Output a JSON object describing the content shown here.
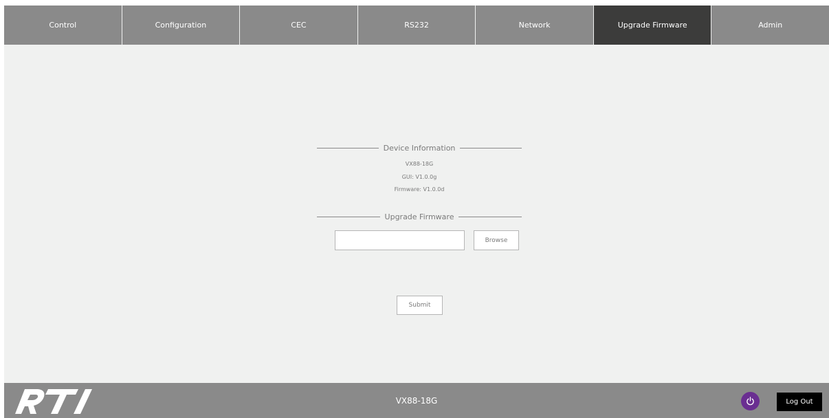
{
  "nav": {
    "tabs": [
      {
        "label": "Control",
        "active": false
      },
      {
        "label": "Configuration",
        "active": false
      },
      {
        "label": "CEC",
        "active": false
      },
      {
        "label": "RS232",
        "active": false
      },
      {
        "label": "Network",
        "active": false
      },
      {
        "label": "Upgrade Firmware",
        "active": true
      },
      {
        "label": "Admin",
        "active": false
      }
    ]
  },
  "device_info": {
    "heading": "Device Information",
    "model": "VX88-18G",
    "gui_version": "GUI: V1.0.0g",
    "firmware_version": "Firmware: V1.0.0d"
  },
  "upgrade": {
    "heading": "Upgrade Firmware",
    "file_value": "",
    "browse_label": "Browse",
    "submit_label": "Submit"
  },
  "footer": {
    "logo": "RTI",
    "device_name": "VX88-18G",
    "power_icon": "power-icon",
    "logout_label": "Log Out"
  },
  "colors": {
    "nav_bg": "#8a8a8a",
    "nav_active": "#3c3c3b",
    "content_bg": "#f0f1f0",
    "power_accent": "#6a2e91",
    "logout_bg": "#000000"
  }
}
